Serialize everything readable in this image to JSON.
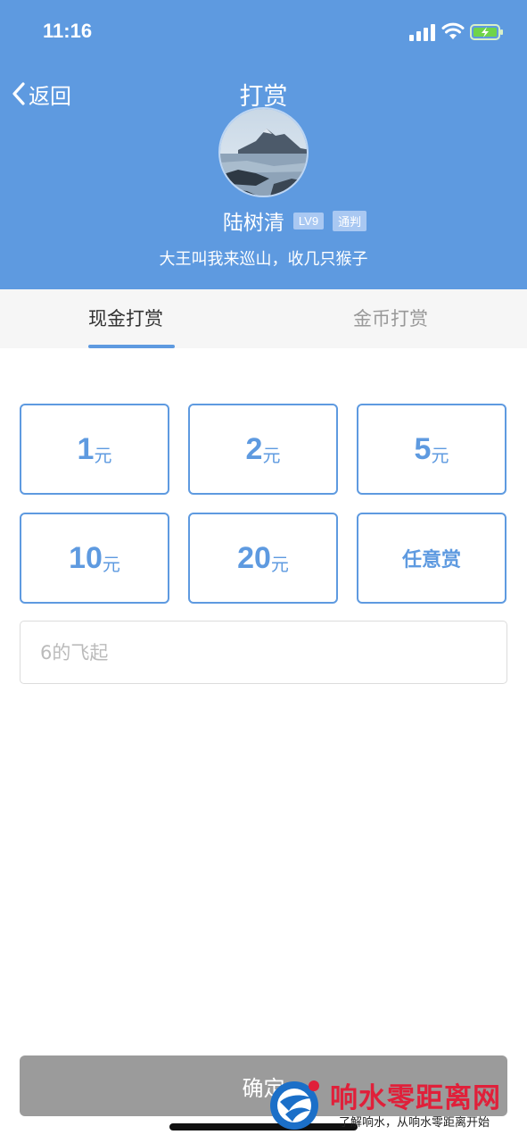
{
  "status_bar": {
    "time": "11:16"
  },
  "header": {
    "back_label": "返回",
    "title": "打赏",
    "username": "陆树清",
    "level_badge": "LV9",
    "role_badge": "通判",
    "signature": "大王叫我来巡山，收几只猴子"
  },
  "tabs": [
    {
      "label": "现金打赏",
      "active": true
    },
    {
      "label": "金币打赏",
      "active": false
    }
  ],
  "amounts": [
    {
      "value": "1",
      "unit": "元"
    },
    {
      "value": "2",
      "unit": "元"
    },
    {
      "value": "5",
      "unit": "元"
    },
    {
      "value": "10",
      "unit": "元"
    },
    {
      "value": "20",
      "unit": "元"
    }
  ],
  "any_amount_label": "任意赏",
  "custom_input": {
    "placeholder": "6的飞起"
  },
  "confirm_label": "确定",
  "watermark": {
    "title": "响水零距离网",
    "subtitle": "了解响水，从响水零距离开始"
  },
  "colors": {
    "primary": "#5e9ae0",
    "button_disabled": "#9b9b9b",
    "watermark_red": "#e0203a"
  }
}
